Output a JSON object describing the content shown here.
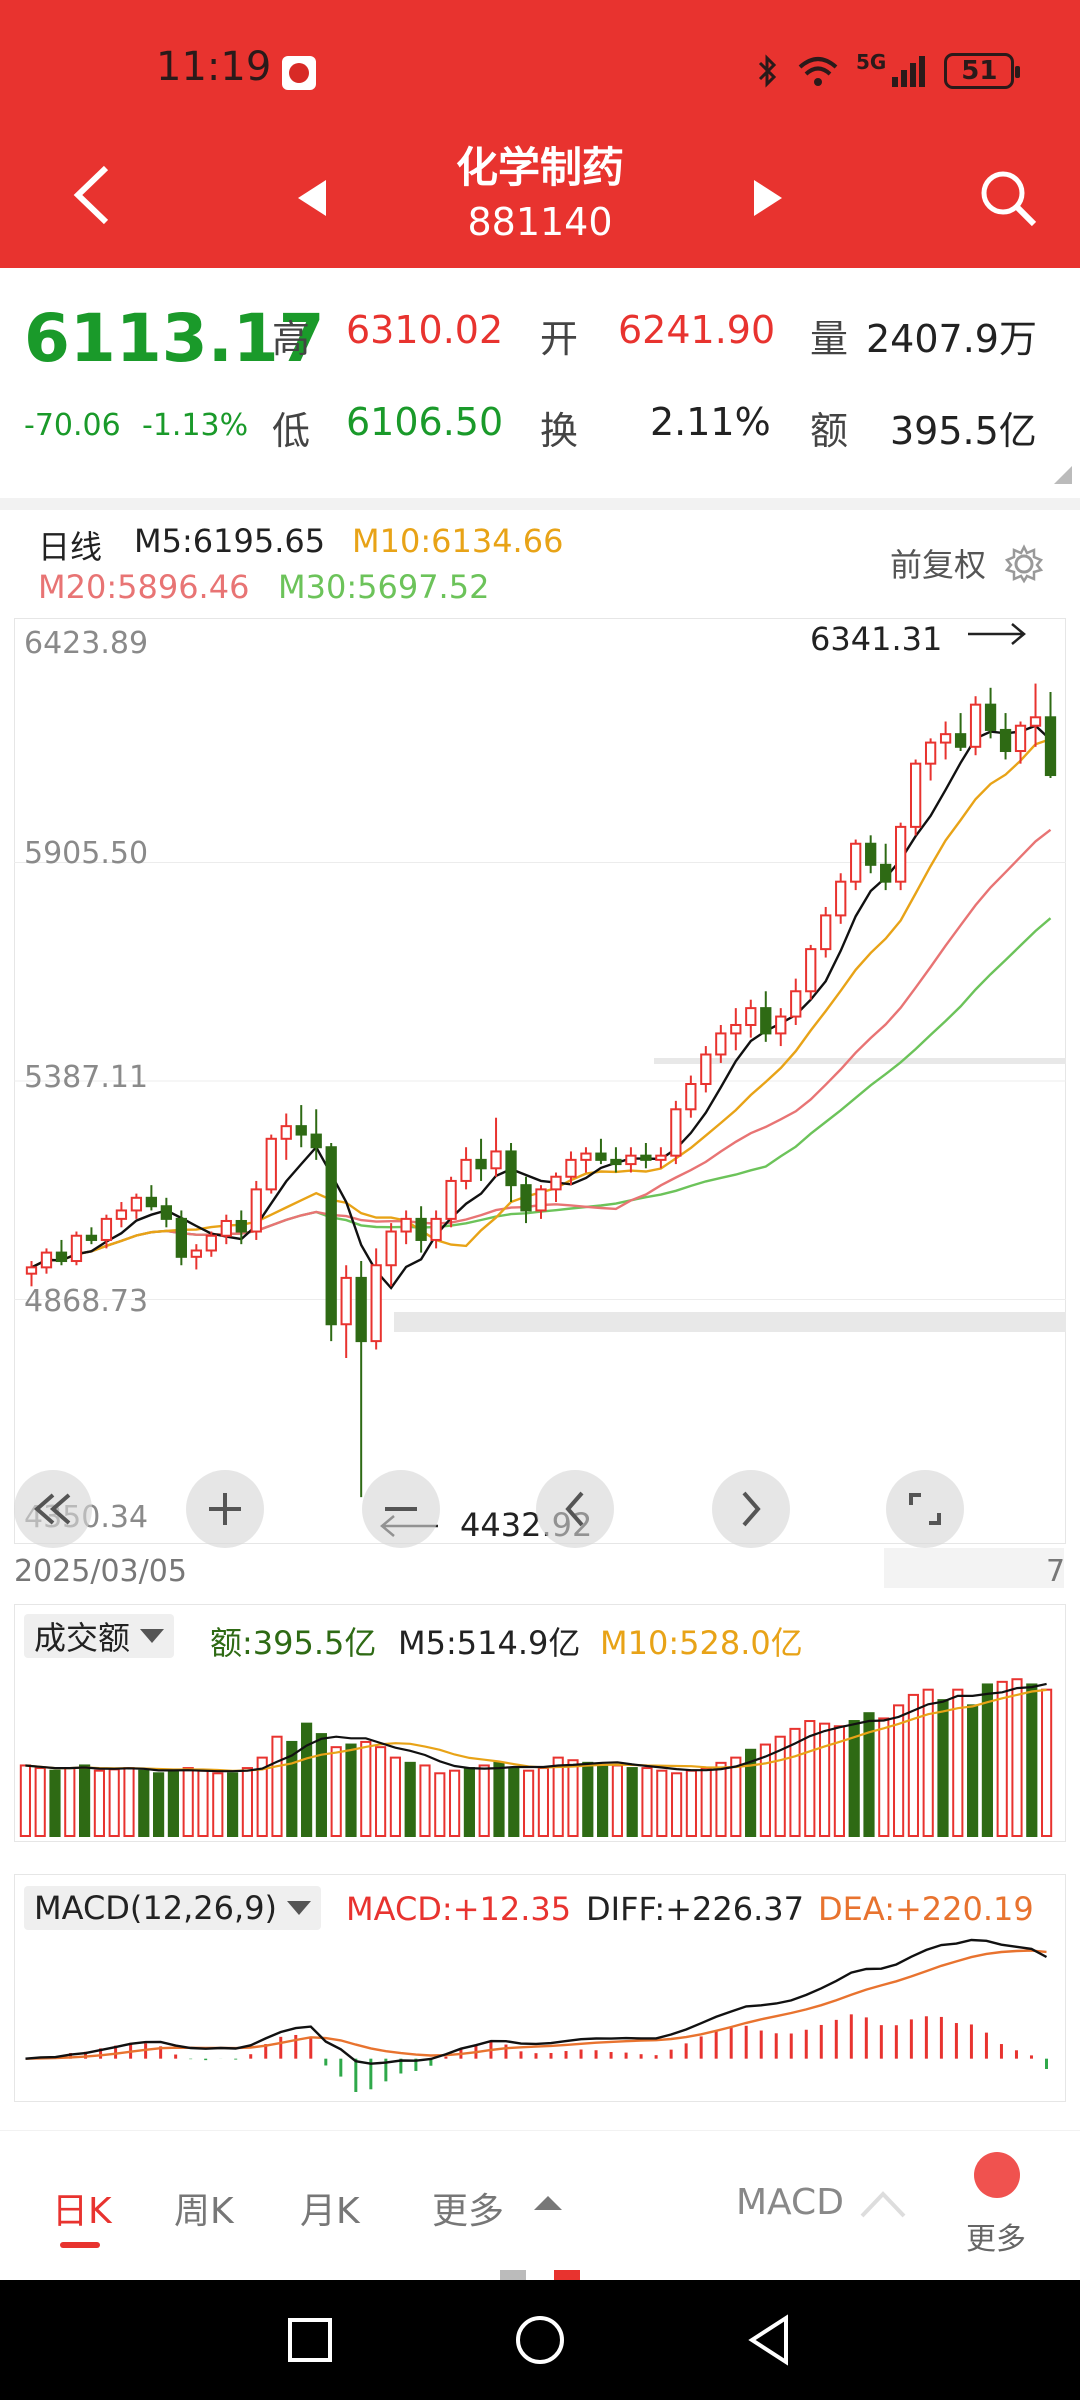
{
  "status_bar": {
    "time": "11:19",
    "network": "5G",
    "battery": "51"
  },
  "header": {
    "title": "化学制药",
    "code": "881140"
  },
  "quote": {
    "price": "6113.17",
    "change": "-70.06",
    "change_pct": "-1.13%",
    "high_label": "高",
    "high": "6310.02",
    "open_label": "开",
    "open": "6241.90",
    "volume_label": "量",
    "volume": "2407.9万",
    "low_label": "低",
    "low": "6106.50",
    "turnover_label": "换",
    "turnover": "2.11%",
    "amount_label": "额",
    "amount": "395.5亿"
  },
  "ma_legend": {
    "period": "日线",
    "m5": "M5:6195.65",
    "m10": "M10:6134.66",
    "m20": "M20:5896.46",
    "m30": "M30:5697.52",
    "adjust": "前复权"
  },
  "colors": {
    "up": "#e8332f",
    "down": "#2e6a14",
    "m5": "#111111",
    "m10": "#e8a317",
    "m20": "#e87474",
    "m30": "#6cc35a",
    "accent": "#e8332f"
  },
  "price_axis": [
    "6423.89",
    "5905.50",
    "5387.11",
    "4868.73",
    "4350.34"
  ],
  "annotations": {
    "high_price": "6341.31",
    "low_price": "4432.92"
  },
  "dates": {
    "start": "2025/03/05",
    "end": "7"
  },
  "chart_controls": [
    "rewind-icon",
    "zoom-in-icon",
    "zoom-out-icon",
    "chevron-left-icon",
    "chevron-right-icon",
    "fullscreen-icon"
  ],
  "volume_panel": {
    "selector": "成交额",
    "amount": "额:395.5亿",
    "m5": "M5:514.9亿",
    "m10": "M10:528.0亿",
    "values": [
      270,
      260,
      250,
      260,
      270,
      250,
      255,
      260,
      250,
      240,
      250,
      260,
      250,
      240,
      240,
      260,
      300,
      380,
      360,
      430,
      390,
      340,
      350,
      360,
      340,
      300,
      280,
      270,
      240,
      250,
      260,
      270,
      280,
      260,
      250,
      260,
      300,
      290,
      280,
      270,
      270,
      260,
      260,
      250,
      240,
      250,
      260,
      280,
      300,
      330,
      350,
      380,
      410,
      440,
      430,
      420,
      440,
      470,
      450,
      500,
      540,
      560,
      520,
      560,
      500,
      580,
      590,
      600,
      580,
      560
    ]
  },
  "macd_panel": {
    "selector": "MACD(12,26,9)",
    "macd": "MACD:+12.35",
    "diff": "DIFF:+226.37",
    "dea": "DEA:+220.19"
  },
  "tabs": {
    "day": "日K",
    "week": "周K",
    "month": "月K",
    "more": "更多",
    "indicator": "MACD",
    "more_bottom": "更多"
  },
  "chart_data": {
    "type": "candlestick",
    "ylim": [
      4350.34,
      6423.89
    ],
    "candles": [
      [
        4930,
        4960,
        4900,
        4945
      ],
      [
        4945,
        4990,
        4930,
        4980
      ],
      [
        4980,
        5010,
        4950,
        4960
      ],
      [
        4960,
        5030,
        4950,
        5020
      ],
      [
        5020,
        5040,
        5000,
        5010
      ],
      [
        5010,
        5070,
        4990,
        5060
      ],
      [
        5060,
        5100,
        5040,
        5080
      ],
      [
        5080,
        5120,
        5060,
        5110
      ],
      [
        5110,
        5140,
        5080,
        5090
      ],
      [
        5090,
        5110,
        5040,
        5060
      ],
      [
        5060,
        5080,
        4950,
        4970
      ],
      [
        4970,
        5000,
        4940,
        4985
      ],
      [
        4985,
        5030,
        4970,
        5020
      ],
      [
        5020,
        5070,
        5000,
        5055
      ],
      [
        5055,
        5080,
        5000,
        5030
      ],
      [
        5030,
        5150,
        5010,
        5130
      ],
      [
        5130,
        5260,
        5120,
        5250
      ],
      [
        5250,
        5310,
        5200,
        5280
      ],
      [
        5280,
        5330,
        5230,
        5260
      ],
      [
        5260,
        5320,
        5200,
        5230
      ],
      [
        5230,
        5240,
        4770,
        4810
      ],
      [
        4810,
        4950,
        4730,
        4920
      ],
      [
        4920,
        4960,
        4400,
        4770
      ],
      [
        4770,
        4990,
        4750,
        4950
      ],
      [
        4950,
        5050,
        4900,
        5030
      ],
      [
        5030,
        5080,
        5000,
        5060
      ],
      [
        5060,
        5090,
        4980,
        5010
      ],
      [
        5010,
        5080,
        4990,
        5060
      ],
      [
        5060,
        5160,
        5040,
        5150
      ],
      [
        5150,
        5230,
        5130,
        5200
      ],
      [
        5200,
        5250,
        5150,
        5180
      ],
      [
        5180,
        5300,
        5160,
        5220
      ],
      [
        5220,
        5240,
        5100,
        5140
      ],
      [
        5140,
        5160,
        5050,
        5080
      ],
      [
        5080,
        5140,
        5060,
        5130
      ],
      [
        5130,
        5170,
        5100,
        5160
      ],
      [
        5160,
        5220,
        5140,
        5200
      ],
      [
        5200,
        5230,
        5170,
        5215
      ],
      [
        5215,
        5250,
        5190,
        5200
      ],
      [
        5200,
        5230,
        5170,
        5190
      ],
      [
        5190,
        5230,
        5170,
        5210
      ],
      [
        5210,
        5240,
        5180,
        5200
      ],
      [
        5200,
        5230,
        5180,
        5210
      ],
      [
        5210,
        5340,
        5190,
        5320
      ],
      [
        5320,
        5400,
        5300,
        5380
      ],
      [
        5380,
        5470,
        5360,
        5450
      ],
      [
        5450,
        5520,
        5430,
        5500
      ],
      [
        5500,
        5560,
        5460,
        5520
      ],
      [
        5520,
        5580,
        5490,
        5560
      ],
      [
        5560,
        5600,
        5480,
        5500
      ],
      [
        5500,
        5560,
        5470,
        5540
      ],
      [
        5540,
        5630,
        5520,
        5600
      ],
      [
        5600,
        5710,
        5580,
        5700
      ],
      [
        5700,
        5800,
        5680,
        5780
      ],
      [
        5780,
        5880,
        5760,
        5860
      ],
      [
        5860,
        5960,
        5840,
        5950
      ],
      [
        5950,
        5970,
        5880,
        5900
      ],
      [
        5900,
        5950,
        5840,
        5860
      ],
      [
        5860,
        6000,
        5840,
        5990
      ],
      [
        5990,
        6150,
        5970,
        6140
      ],
      [
        6140,
        6200,
        6100,
        6190
      ],
      [
        6190,
        6240,
        6150,
        6210
      ],
      [
        6210,
        6260,
        6170,
        6180
      ],
      [
        6180,
        6300,
        6160,
        6280
      ],
      [
        6280,
        6320,
        6200,
        6220
      ],
      [
        6220,
        6260,
        6150,
        6170
      ],
      [
        6170,
        6240,
        6140,
        6230
      ],
      [
        6230,
        6330,
        6180,
        6250
      ],
      [
        6250,
        6310,
        6106,
        6113
      ]
    ]
  }
}
